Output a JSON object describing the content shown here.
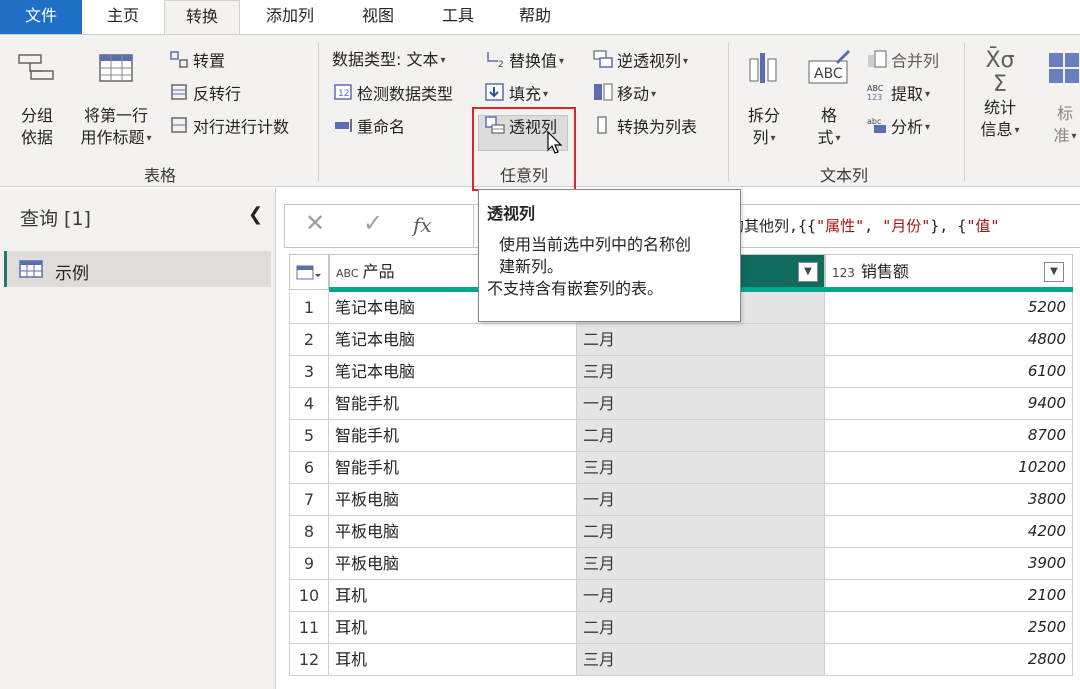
{
  "tabs": [
    "文件",
    "主页",
    "转换",
    "添加列",
    "视图",
    "工具",
    "帮助"
  ],
  "ribbon": {
    "table_group": {
      "label": "表格",
      "group_by": [
        "分组",
        "依据"
      ],
      "use_first_row": [
        "将第一行",
        "用作标题"
      ],
      "transpose": "转置",
      "reverse_rows": "反转行",
      "count_rows": "对行进行计数"
    },
    "any_column_group": {
      "label": "任意列",
      "data_type": "数据类型: 文本",
      "detect_type": "检测数据类型",
      "rename": "重命名",
      "replace_values": "替换值",
      "fill": "填充",
      "pivot_column": "透视列",
      "unpivot_columns": "逆透视列",
      "move": "移动",
      "convert_to_list": "转换为列表"
    },
    "text_column_group": {
      "label": "文本列",
      "split_column": [
        "拆分",
        "列"
      ],
      "format": [
        "格",
        "式"
      ],
      "merge_columns": "合并列",
      "extract": "提取",
      "parse": "分析"
    },
    "number_group": {
      "statistics": [
        "统计",
        "信息"
      ],
      "standard": [
        "标",
        "准"
      ]
    }
  },
  "queries": {
    "title": "查询 [1]",
    "items": [
      {
        "label": "示例"
      }
    ]
  },
  "formula": {
    "text_prefix": "视的其他列,{{",
    "str1": "\"属性\"",
    "sep1": ", ",
    "str2": "\"月份\"",
    "sep2": "}, {",
    "str3": "\"值\""
  },
  "table": {
    "columns": [
      {
        "type_icon": "ABC",
        "name": "产品"
      },
      {
        "type_icon": "",
        "name": ""
      },
      {
        "type_icon": "123",
        "name": "销售额"
      }
    ],
    "rows": [
      {
        "n": "1",
        "product": "笔记本电脑",
        "month": "",
        "sales": "5200"
      },
      {
        "n": "2",
        "product": "笔记本电脑",
        "month": "二月",
        "sales": "4800"
      },
      {
        "n": "3",
        "product": "笔记本电脑",
        "month": "三月",
        "sales": "6100"
      },
      {
        "n": "4",
        "product": "智能手机",
        "month": "一月",
        "sales": "9400"
      },
      {
        "n": "5",
        "product": "智能手机",
        "month": "二月",
        "sales": "8700"
      },
      {
        "n": "6",
        "product": "智能手机",
        "month": "三月",
        "sales": "10200"
      },
      {
        "n": "7",
        "product": "平板电脑",
        "month": "一月",
        "sales": "3800"
      },
      {
        "n": "8",
        "product": "平板电脑",
        "month": "二月",
        "sales": "4200"
      },
      {
        "n": "9",
        "product": "平板电脑",
        "month": "三月",
        "sales": "3900"
      },
      {
        "n": "10",
        "product": "耳机",
        "month": "一月",
        "sales": "2100"
      },
      {
        "n": "11",
        "product": "耳机",
        "month": "二月",
        "sales": "2500"
      },
      {
        "n": "12",
        "product": "耳机",
        "month": "三月",
        "sales": "2800"
      }
    ]
  },
  "tooltip": {
    "title": "透视列",
    "line1": "使用当前选中列中的名称创",
    "line2": "建新列。",
    "line3": "不支持含有嵌套列的表。"
  },
  "colors": {
    "file_tab": "#1f6fc7",
    "selected_header": "#106b5e",
    "quality_bar": "#00a88f",
    "highlight": "#d9262a"
  }
}
